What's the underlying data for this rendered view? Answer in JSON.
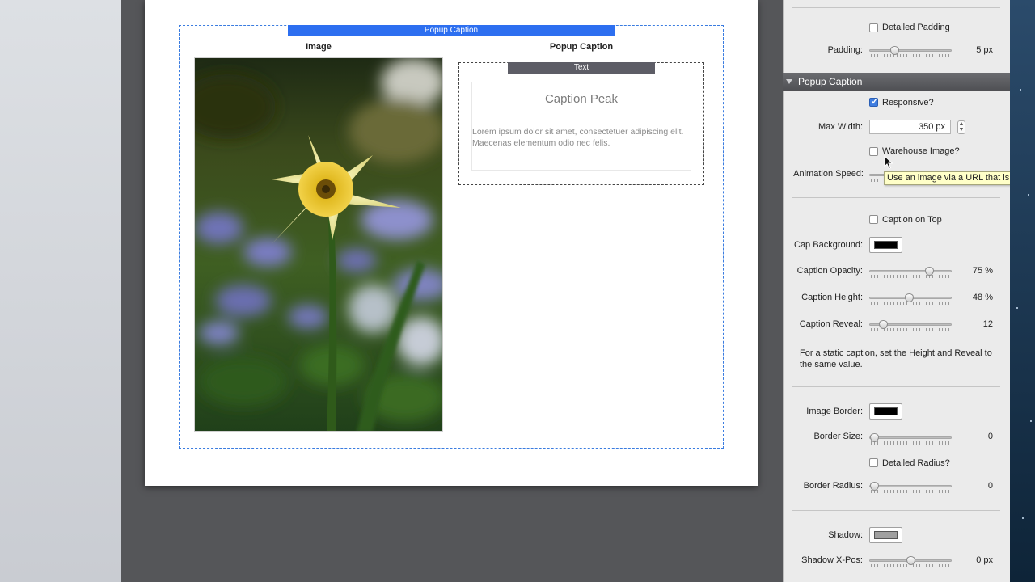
{
  "canvas": {
    "popup_tab_label": "Popup Caption",
    "image_heading": "Image",
    "caption_heading": "Popup Caption",
    "text_tab_label": "Text",
    "caption_title": "Caption Peak",
    "caption_body": "Lorem ipsum dolor sit amet, consectetuer adipiscing elit. Maecenas elementum odio nec felis."
  },
  "panel": {
    "detailed_padding_label": "Detailed Padding",
    "padding_label": "Padding:",
    "padding_value": "5 px",
    "section_title": "Popup Caption",
    "responsive_label": "Responsive?",
    "max_width_label": "Max Width:",
    "max_width_value": "350 px",
    "warehouse_image_label": "Warehouse Image?",
    "animation_speed_label": "Animation Speed:",
    "tooltip_text": "Use an image via a URL that is ware",
    "caption_on_top_label": "Caption on Top",
    "cap_background_label": "Cap Background:",
    "cap_background_color": "#000000",
    "caption_opacity_label": "Caption Opacity:",
    "caption_opacity_value": "75 %",
    "caption_height_label": "Caption Height:",
    "caption_height_value": "48 %",
    "caption_reveal_label": "Caption Reveal:",
    "caption_reveal_value": "12",
    "help_text": "For a static caption, set the Height and Reveal to the same value.",
    "image_border_label": "Image Border:",
    "image_border_color": "#000000",
    "border_size_label": "Border Size:",
    "border_size_value": "0",
    "detailed_radius_label": "Detailed Radius?",
    "border_radius_label": "Border Radius:",
    "border_radius_value": "0",
    "shadow_label": "Shadow:",
    "shadow_color": "#a0a0a0",
    "shadow_xpos_label": "Shadow X-Pos:",
    "shadow_xpos_value": "0 px"
  },
  "state": {
    "detailed_padding_checked": false,
    "responsive_checked": true,
    "warehouse_image_checked": false,
    "caption_on_top_checked": false,
    "detailed_radius_checked": false,
    "padding_slider": 0.28,
    "caption_opacity_slider": 0.75,
    "caption_height_slider": 0.48,
    "caption_reveal_slider": 0.12,
    "border_size_slider": 0.0,
    "border_radius_slider": 0.0,
    "shadow_xpos_slider": 0.5
  },
  "icons": {
    "cursor": "arrow-cursor-icon",
    "stepper": "stepper-arrows-icon",
    "section_toggle": "disclosure-triangle-icon"
  }
}
